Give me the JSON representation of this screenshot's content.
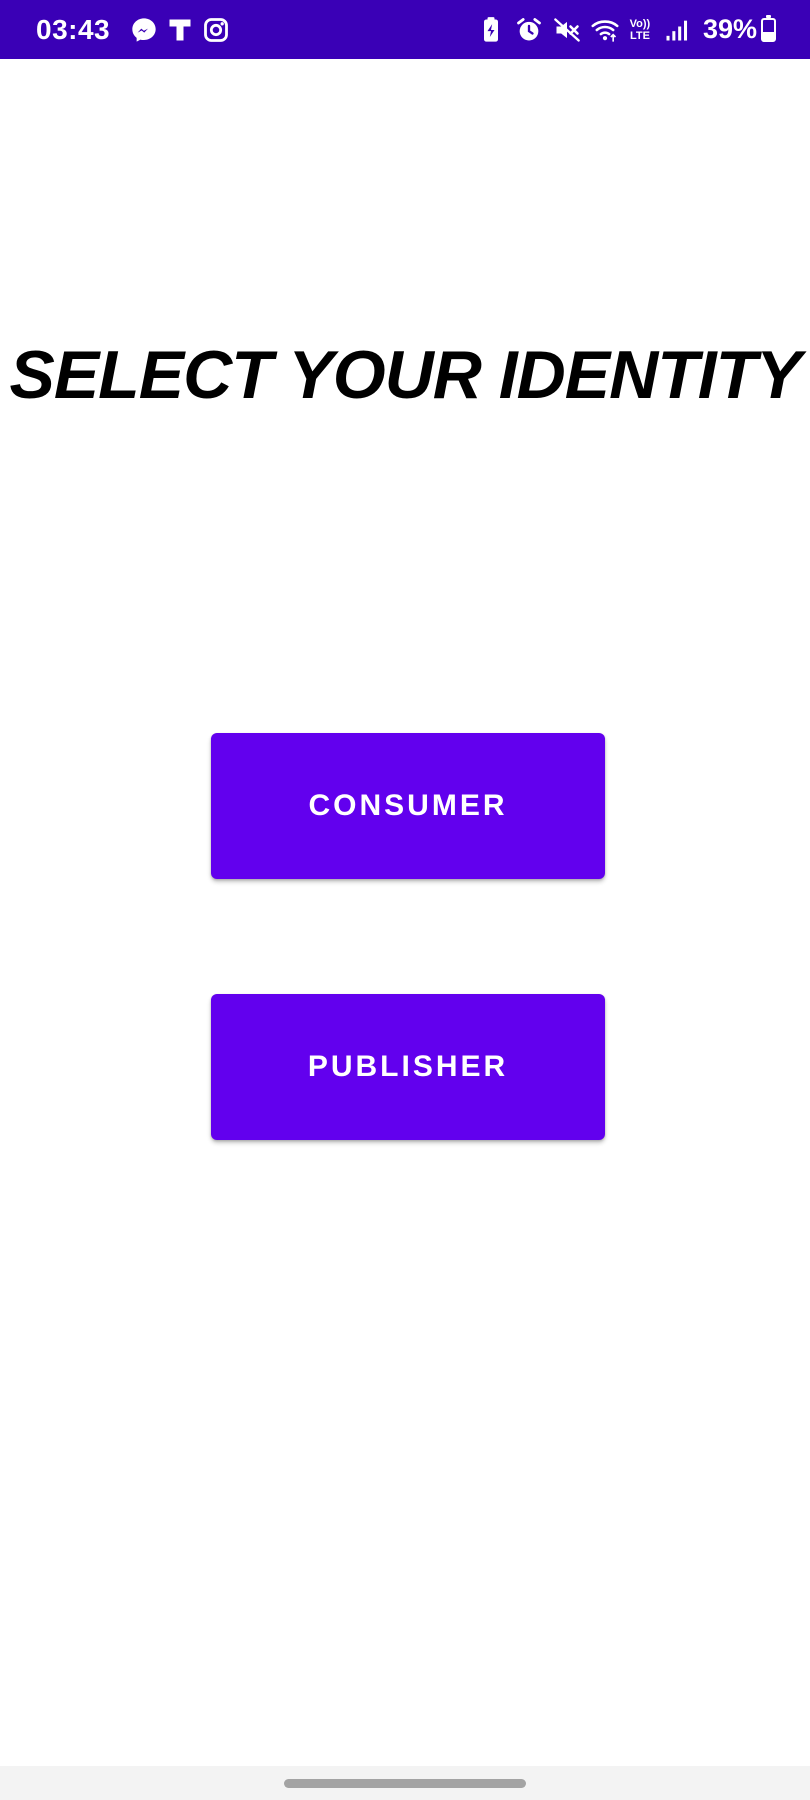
{
  "status_bar": {
    "time": "03:43",
    "notification_icons": [
      "messenger-icon",
      "t-app-icon",
      "instagram-icon"
    ],
    "system_icons": [
      "battery-saver-icon",
      "alarm-icon",
      "mute-icon",
      "wifi-icon",
      "volte-icon",
      "signal-icon"
    ],
    "volte_top": "Vo))",
    "volte_bottom": "LTE",
    "battery_percent": "39%",
    "battery_level": 0.39,
    "background_color": "#3a00b6"
  },
  "page": {
    "title": "SELECT YOUR IDENTITY"
  },
  "buttons": {
    "consumer_label": "CONSUMER",
    "publisher_label": "PUBLISHER",
    "accent_color": "#6200ee"
  },
  "nav_bar": {
    "handle": "home-handle"
  }
}
